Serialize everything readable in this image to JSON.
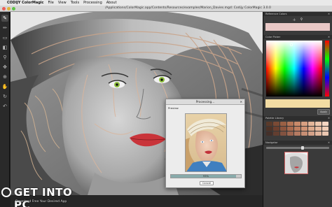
{
  "menubar": {
    "apple_glyph": "",
    "app_name": "CODIJY ColorMagic",
    "items": [
      "File",
      "View",
      "Tools",
      "Processing",
      "About"
    ]
  },
  "window": {
    "title": "/Applications/ColorMagic.app/Contents/Resources/examples/Marion_Davies.mgd: Codijy ColorMagic 3.0.0"
  },
  "toolbar": {
    "tools": [
      "brush-tool",
      "pencil-tool",
      "eraser-tool",
      "fill-tool",
      "picker-tool",
      "move-tool",
      "zoom-tool"
    ]
  },
  "right_panel": {
    "section_reference": "Reference Colors",
    "section_color_picker": "Color Picker",
    "section_palette": "Palette Library",
    "section_navigator": "Navigator",
    "apply_label": "Apply",
    "colors": {
      "reference_swatch": "#e9c8c6",
      "picked_swatch": "#f3dca3"
    }
  },
  "dialog": {
    "title": "Processing...",
    "preview_label": "Preview",
    "progress_value": 0.93,
    "progress_text": "93%",
    "cancel_label": "Cancel"
  },
  "watermark": {
    "main": "GET INTO PC",
    "sub": "Download Free Your Desired App"
  }
}
